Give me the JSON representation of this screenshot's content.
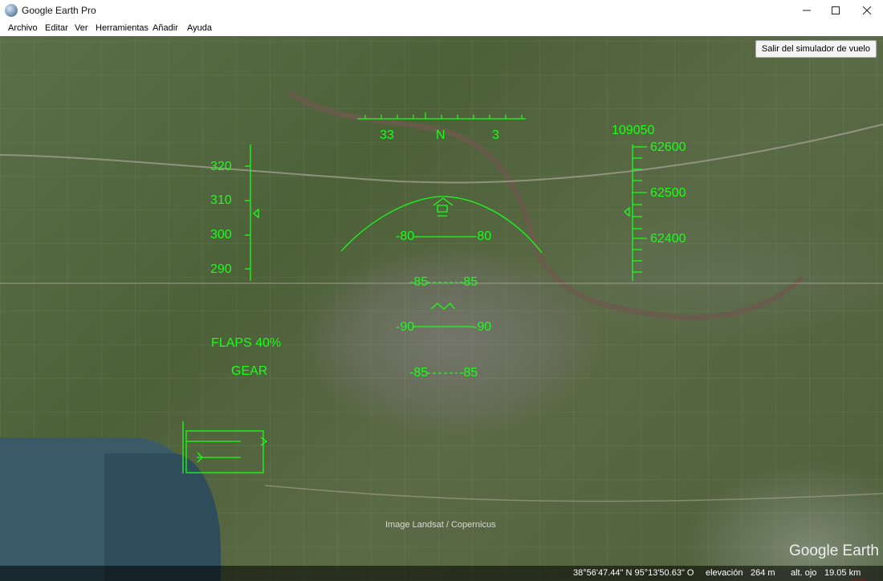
{
  "window": {
    "title": "Google Earth Pro"
  },
  "menu": {
    "items": [
      "Archivo",
      "Editar",
      "Ver",
      "Herramientas",
      "Añadir",
      "Ayuda"
    ]
  },
  "map": {
    "exit_flight_sim_button": "Salir del simulador de vuelo",
    "attribution": "Image Landsat / Copernicus",
    "logo": "Google Earth"
  },
  "hud": {
    "heading": {
      "left": "33",
      "center": "N",
      "right": "3"
    },
    "speed_ticks": [
      "320",
      "310",
      "300",
      "290"
    ],
    "altitude_top": "109050",
    "altitude_ticks": [
      "62600",
      "62500",
      "62400"
    ],
    "pitch_ladder": [
      {
        "left": "-80",
        "right": "-80"
      },
      {
        "left": "-85",
        "right": "-85"
      },
      {
        "left": "-90",
        "right": "-90"
      },
      {
        "left": "-85",
        "right": "-85"
      }
    ],
    "flaps": "FLAPS 40%",
    "gear": "GEAR",
    "color": "#19ff19"
  },
  "status": {
    "coordinates": "38°56'47.44\" N   95°13'50.63\" O",
    "elevation_label": "elevación",
    "elevation": "264 m",
    "eye_alt_label": "alt. ojo",
    "eye_alt": "19.05 km"
  }
}
